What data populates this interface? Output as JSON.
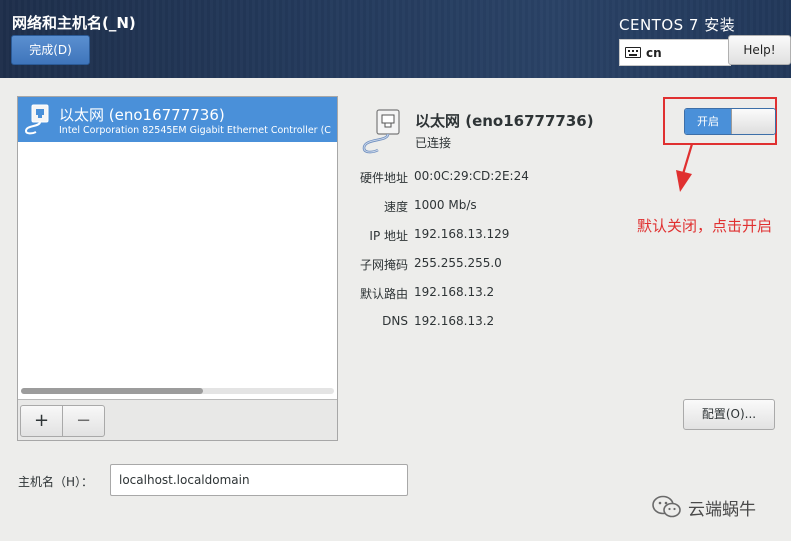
{
  "header": {
    "page_title": "网络和主机名(_N)",
    "done_label": "完成(D)",
    "install_title": "CENTOS 7 安装",
    "keyboard_layout": "cn",
    "help_label": "Help!"
  },
  "device_list": {
    "items": [
      {
        "name": "以太网 (eno16777736)",
        "description": "Intel Corporation 82545EM Gigabit Ethernet Controller (C",
        "selected": true,
        "icon": "ethernet-port-icon"
      }
    ],
    "add_label": "+",
    "remove_label": "−"
  },
  "details": {
    "name": "以太网 (eno16777736)",
    "status": "已连接",
    "switch_label": "开启",
    "switch_on": true,
    "properties": [
      {
        "label": "硬件地址",
        "value": "00:0C:29:CD:2E:24"
      },
      {
        "label": "速度",
        "value": "1000 Mb/s"
      },
      {
        "label": "IP 地址",
        "value": "192.168.13.129"
      },
      {
        "label": "子网掩码",
        "value": "255.255.255.0"
      },
      {
        "label": "默认路由",
        "value": "192.168.13.2"
      },
      {
        "label": "DNS",
        "value": "192.168.13.2"
      }
    ],
    "configure_label": "配置(O)..."
  },
  "annotation": {
    "text": "默认关闭，点击开启",
    "color": "#e03030"
  },
  "hostname": {
    "label": "主机名（H）：",
    "value": "localhost.localdomain"
  },
  "watermark": {
    "text": "云端蜗牛",
    "icon": "wechat-icon"
  },
  "colors": {
    "accent": "#4a90d9",
    "header": "#243a5c",
    "annotation": "#e03030"
  }
}
